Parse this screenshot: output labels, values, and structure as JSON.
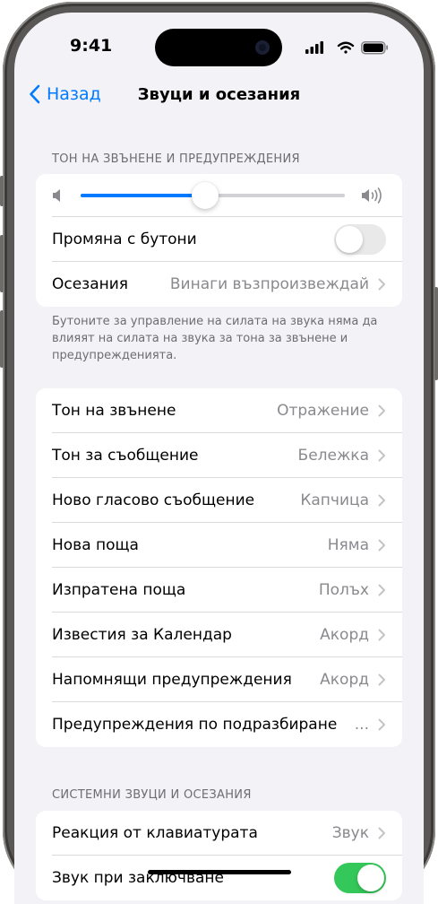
{
  "status_bar": {
    "time": "9:41"
  },
  "navbar": {
    "back_label": "Назад",
    "title": "Звуци и осезания"
  },
  "ringtone_section": {
    "header": "ТОН НА ЗВЪНЕНЕ И ПРЕДУПРЕЖДЕНИЯ",
    "volume_level": 0.47,
    "change_with_buttons": {
      "label": "Промяна с бутони",
      "on": false
    },
    "haptics": {
      "label": "Осезания",
      "value": "Винаги възпроизвеждай"
    },
    "footnote": "Бутоните за управление на силата на звука няма да влияят на силата на звука за тона за звънене и предупрежденията."
  },
  "sounds_list": [
    {
      "label": "Тон на звънене",
      "value": "Отражение"
    },
    {
      "label": "Тон за съобщение",
      "value": "Бележка"
    },
    {
      "label": "Ново гласово съобщение",
      "value": "Капчица"
    },
    {
      "label": "Нова поща",
      "value": "Няма"
    },
    {
      "label": "Изпратена поща",
      "value": "Полъх"
    },
    {
      "label": "Известия за Календар",
      "value": "Акорд"
    },
    {
      "label": "Напомнящи предупреждения",
      "value": "Акорд"
    },
    {
      "label": "Предупреждения по подразбиране",
      "value": "..."
    }
  ],
  "system_section": {
    "header": "СИСТЕМНИ ЗВУЦИ И ОСЕЗАНИЯ",
    "keyboard_feedback": {
      "label": "Реакция от клавиатурата",
      "value": "Звук"
    },
    "lock_sound": {
      "label": "Звук при заключване",
      "on": true
    }
  },
  "colors": {
    "accent": "#007aff",
    "toggle_on": "#34c759",
    "background": "#f2f2f7"
  }
}
